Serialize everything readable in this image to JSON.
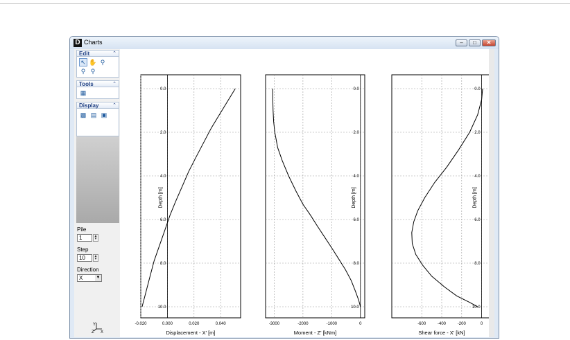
{
  "window": {
    "title": "Charts",
    "app_icon_letter": "D"
  },
  "left_panel": {
    "edit": {
      "title": "Edit",
      "tools": [
        "select-arrow-icon",
        "hand-pan-icon",
        "zoom-icon",
        "zoom-in-icon",
        "zoom-out-icon"
      ]
    },
    "tools": {
      "title": "Tools",
      "tools": [
        "chart-tool-icon"
      ]
    },
    "display": {
      "title": "Display",
      "tools": [
        "display-fit-icon",
        "display-page-icon",
        "display-export-icon"
      ]
    },
    "pile": {
      "label": "Pile",
      "value": "1"
    },
    "step": {
      "label": "Step",
      "value": "10"
    },
    "direction": {
      "label": "Direction",
      "value": "X"
    },
    "axes_labels": {
      "y": "Y",
      "z": "Z",
      "x": "X"
    }
  },
  "chart_data": [
    {
      "type": "line",
      "xlabel": "Displacement - X' [m]",
      "ylabel": "Depth [m]",
      "xlim": [
        -0.02,
        0.055
      ],
      "xticks": [
        -0.02,
        0.0,
        0.02,
        0.04
      ],
      "xtick_labels": [
        "-0.020",
        "0.000",
        "0.020",
        "0.040"
      ],
      "ylim": [
        0,
        10
      ],
      "yticks": [
        0,
        2,
        4,
        6,
        8,
        10
      ],
      "ytick_labels": [
        "0.0",
        "2.0",
        "4.0",
        "6.0",
        "8.0",
        "10.0"
      ],
      "y_inverted": true,
      "grid": true,
      "x": [
        0.051,
        0.045,
        0.039,
        0.033,
        0.027,
        0.021,
        0.016,
        0.011,
        0.006,
        0.002,
        -0.002,
        -0.006,
        -0.01,
        -0.013,
        -0.016,
        -0.019
      ],
      "y": [
        0,
        0.6,
        1.2,
        1.8,
        2.5,
        3.2,
        3.8,
        4.5,
        5.2,
        5.8,
        6.5,
        7.2,
        7.9,
        8.6,
        9.3,
        10
      ]
    },
    {
      "type": "line",
      "xlabel": "Moment - Z' [kNm]",
      "ylabel": "Depth [m]",
      "xlim": [
        -3300,
        150
      ],
      "xticks": [
        -3000,
        -2000,
        -1000,
        0
      ],
      "xtick_labels": [
        "-3000",
        "-2000",
        "-1000",
        "0"
      ],
      "ylim": [
        0,
        10
      ],
      "yticks": [
        0,
        2,
        4,
        6,
        8,
        10
      ],
      "ytick_labels": [
        "0.0",
        "2.0",
        "4.0",
        "6.0",
        "8.0",
        "10.0"
      ],
      "y_inverted": true,
      "grid": true,
      "x": [
        -3050,
        -3050,
        -3040,
        -3020,
        -2980,
        -2880,
        -2720,
        -2500,
        -2240,
        -2000,
        -1740,
        -1500,
        -1250,
        -1000,
        -760,
        -520,
        -320,
        -170,
        -60,
        0
      ],
      "y": [
        0,
        0.5,
        1.0,
        1.5,
        2.0,
        2.7,
        3.3,
        4.0,
        4.7,
        5.3,
        5.8,
        6.3,
        6.8,
        7.3,
        7.8,
        8.3,
        8.8,
        9.3,
        9.7,
        10
      ]
    },
    {
      "type": "line",
      "xlabel": "Shear force - X' [kN]",
      "ylabel": "Depth [m]",
      "xlim": [
        -900,
        100
      ],
      "xticks": [
        -600,
        -400,
        -200,
        0
      ],
      "xtick_labels": [
        "-600",
        "-400",
        "-200",
        "0"
      ],
      "ylim": [
        0,
        10
      ],
      "yticks": [
        0,
        2,
        4,
        6,
        8,
        10
      ],
      "ytick_labels": [
        "0.0",
        "2.0",
        "4.0",
        "6.0",
        "8.0",
        "10.0"
      ],
      "y_inverted": true,
      "grid": true,
      "x": [
        10,
        0,
        -40,
        -120,
        -230,
        -350,
        -470,
        -570,
        -640,
        -680,
        -700,
        -695,
        -660,
        -590,
        -500,
        -370,
        -250,
        -120,
        -40
      ],
      "y": [
        0,
        0.5,
        1.2,
        2.0,
        2.8,
        3.6,
        4.3,
        5.0,
        5.6,
        6.1,
        6.6,
        7.1,
        7.6,
        8.1,
        8.6,
        9.1,
        9.5,
        9.8,
        10
      ]
    }
  ]
}
